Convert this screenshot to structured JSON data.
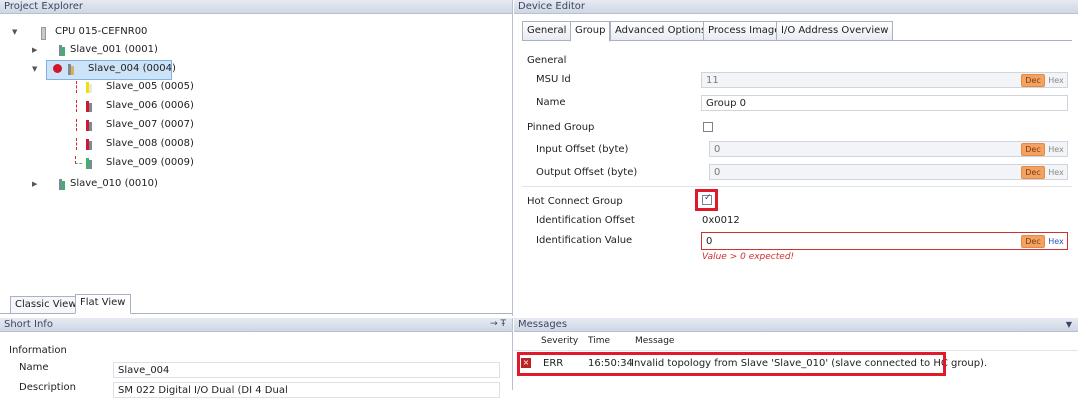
{
  "project_explorer": {
    "title": "Project Explorer",
    "cpu": "CPU 015-CEFNR00",
    "nodes": [
      {
        "label": "Slave_001 (0001)"
      },
      {
        "label": "Slave_004 (0004)"
      },
      {
        "label": "Slave_005 (0005)"
      },
      {
        "label": "Slave_006 (0006)"
      },
      {
        "label": "Slave_007 (0007)"
      },
      {
        "label": "Slave_008 (0008)"
      },
      {
        "label": "Slave_009 (0009)"
      },
      {
        "label": "Slave_010 (0010)"
      }
    ],
    "view_tabs": [
      "Classic View",
      "Flat View"
    ]
  },
  "device_editor": {
    "title": "Device Editor",
    "tabs": [
      "General",
      "Group",
      "Advanced Options",
      "Process Image",
      "I/O Address Overview"
    ],
    "active_tab": "Group",
    "section_general": "General",
    "msu_id_label": "MSU Id",
    "msu_id_value": "11",
    "name_label": "Name",
    "name_value": "Group 0",
    "pinned_group_label": "Pinned Group",
    "pinned_group_checked": false,
    "input_offset_label": "Input Offset (byte)",
    "input_offset_value": "0",
    "output_offset_label": "Output Offset (byte)",
    "output_offset_value": "0",
    "hot_connect_label": "Hot Connect Group",
    "hot_connect_checked": true,
    "ident_offset_label": "Identification Offset",
    "ident_offset_value": "0x0012",
    "ident_value_label": "Identification Value",
    "ident_value_value": "0",
    "ident_value_error": "Value > 0 expected!",
    "dec_label": "Dec",
    "hex_label": "Hex"
  },
  "short_info": {
    "title": "Short Info",
    "pin": "→ Ŧ",
    "section": "Information",
    "name_label": "Name",
    "name_value": "Slave_004",
    "description_label": "Description",
    "description_value": "SM 022 Digital I/O Dual (DI 4 Dual"
  },
  "messages": {
    "title": "Messages",
    "columns": [
      "Severity",
      "Time",
      "Message"
    ],
    "rows": [
      {
        "severity": "ERR",
        "time": "16:50:34",
        "message": "Invalid topology from Slave 'Slave_010' (slave connected to HC group)."
      }
    ]
  },
  "colors": {
    "error_red": "#e0192b",
    "dec_orange": "#f4a262",
    "selection_blue": "#cde3f7"
  }
}
